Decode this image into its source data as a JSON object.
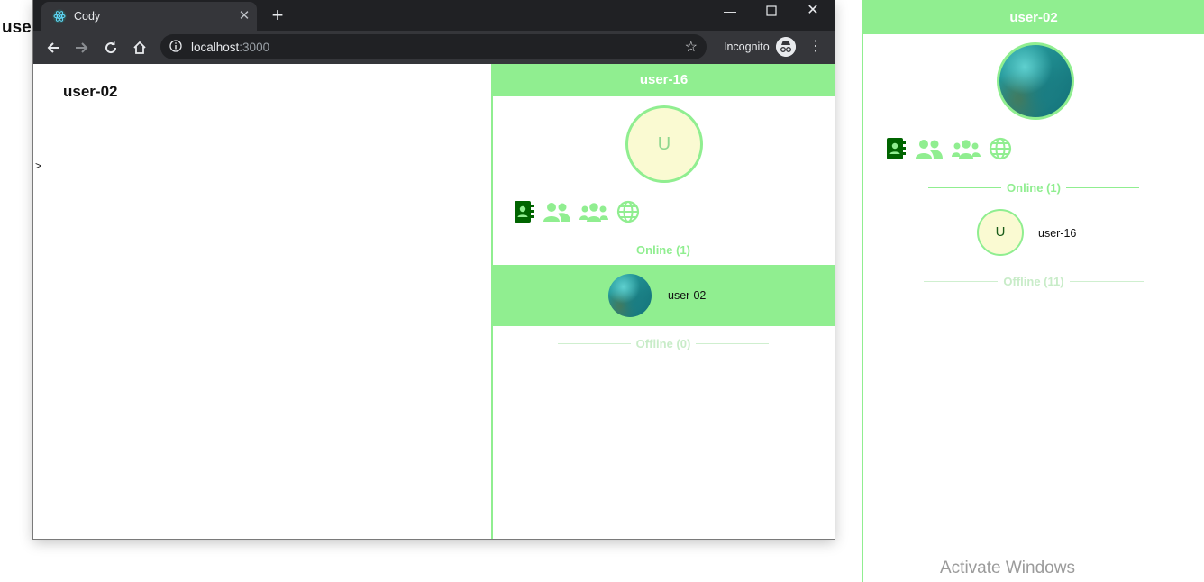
{
  "background_heading": "user",
  "browser": {
    "tab_title": "Cody",
    "url_host": "localhost",
    "url_port": ":3000",
    "incognito_label": "Incognito",
    "icons": {
      "back": "arrow-left-icon",
      "forward": "arrow-right-icon",
      "reload": "reload-icon",
      "home": "home-icon",
      "info": "info-icon",
      "star": "star-icon",
      "close_tab": "close-icon",
      "new_tab": "plus-icon",
      "menu": "kebab-menu-icon"
    }
  },
  "page": {
    "user_title": "user-02",
    "caret": ">"
  },
  "inner_sidebar": {
    "header": "user-16",
    "avatar_letter": "U",
    "online_label": "Online (1)",
    "online_users": [
      {
        "name": "user-02"
      }
    ],
    "offline_label": "Offline (0)"
  },
  "outer_sidebar": {
    "header": "user-02",
    "online_label": "Online (1)",
    "online_users": [
      {
        "name": "user-16",
        "avatar_letter": "U"
      }
    ],
    "offline_label": "Offline (11)"
  },
  "colors": {
    "accent": "#90ee90",
    "active_icon": "#006400",
    "avatar_bg": "#fafad2",
    "chrome_dark": "#202124",
    "chrome_toolbar": "#35363a"
  },
  "watermark": "Activate Windows"
}
